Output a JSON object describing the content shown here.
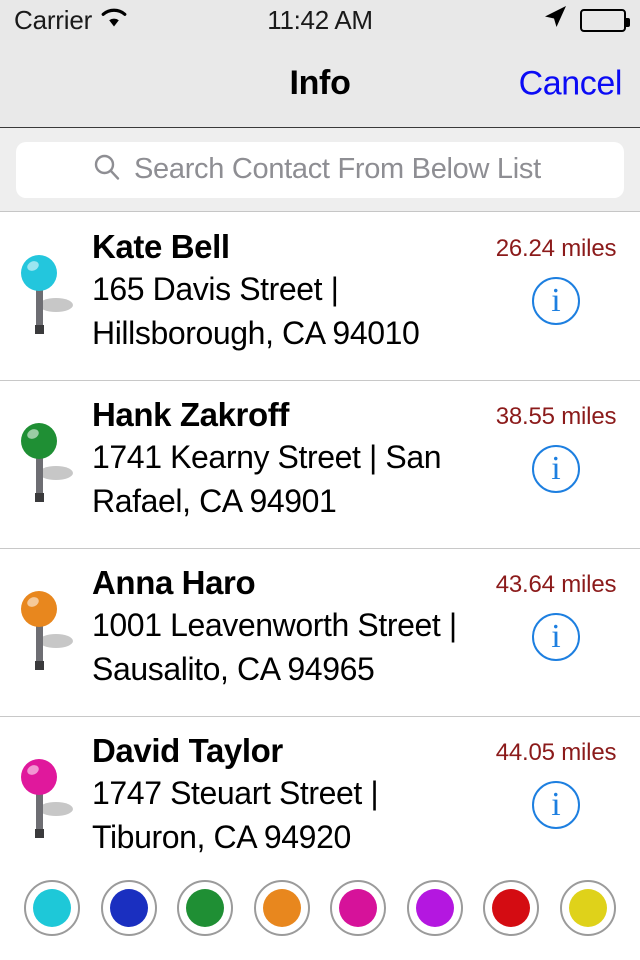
{
  "status_bar": {
    "carrier": "Carrier",
    "wifi_icon": "wifi-icon",
    "time": "11:42 AM",
    "location_icon": "location-arrow-icon",
    "battery_icon": "battery-full-icon"
  },
  "nav_bar": {
    "title": "Info",
    "cancel_label": "Cancel"
  },
  "search": {
    "icon": "search-icon",
    "placeholder": "Search Contact From Below List",
    "value": ""
  },
  "contacts": [
    {
      "name": "Kate Bell",
      "address": "165 Davis Street | Hillsborough, CA 94010",
      "distance": "26.24 miles",
      "pin_color": "#23c6dd",
      "info_icon": "info-circle-icon"
    },
    {
      "name": "Hank Zakroff",
      "address": "1741 Kearny Street | San Rafael, CA 94901",
      "distance": "38.55 miles",
      "pin_color": "#1f8f34",
      "info_icon": "info-circle-icon"
    },
    {
      "name": "Anna Haro",
      "address": "1001  Leavenworth Street | Sausalito, CA 94965",
      "distance": "43.64 miles",
      "pin_color": "#e8871e",
      "info_icon": "info-circle-icon"
    },
    {
      "name": "David Taylor",
      "address": "1747 Steuart Street | Tiburon, CA 94920",
      "distance": "44.05 miles",
      "pin_color": "#e0189c",
      "info_icon": "info-circle-icon"
    }
  ],
  "color_picker": {
    "swatches": [
      {
        "name": "cyan",
        "color": "#1ec8d8"
      },
      {
        "name": "blue",
        "color": "#1a2fc0"
      },
      {
        "name": "green",
        "color": "#1f8f34"
      },
      {
        "name": "orange",
        "color": "#e8871e"
      },
      {
        "name": "magenta",
        "color": "#d6129a"
      },
      {
        "name": "purple",
        "color": "#b417e0"
      },
      {
        "name": "red",
        "color": "#d40c12"
      },
      {
        "name": "yellow",
        "color": "#dfd21a"
      }
    ]
  },
  "colors": {
    "accent_blue": "#0b0bf5",
    "info_blue": "#1d7fe0",
    "distance_red": "#8b1a1a",
    "nav_bg": "#e9e9e9",
    "placeholder_gray": "#8e8e93"
  }
}
